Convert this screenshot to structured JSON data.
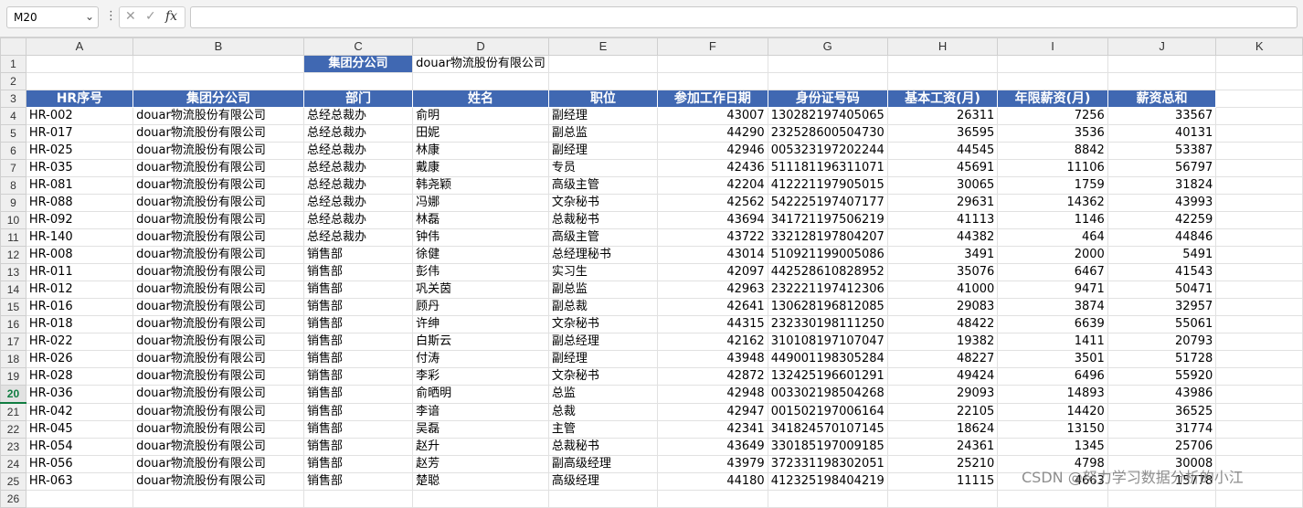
{
  "name_box": {
    "value": "M20"
  },
  "formula_bar": {
    "cancel": "✕",
    "confirm": "✓",
    "fx": "fx",
    "content": ""
  },
  "columns": [
    "A",
    "B",
    "C",
    "D",
    "E",
    "F",
    "G",
    "H",
    "I",
    "J",
    "K"
  ],
  "row1": {
    "label": "集团分公司",
    "value": "douar物流股份有限公司"
  },
  "headers": [
    "HR序号",
    "集团分公司",
    "部门",
    "姓名",
    "职位",
    "参加工作日期",
    "身份证号码",
    "基本工资(月)",
    "年限薪资(月)",
    "薪资总和"
  ],
  "rows": [
    [
      "HR-002",
      "douar物流股份有限公司",
      "总经总裁办",
      "俞明",
      "副经理",
      "43007",
      "130282197405065",
      "26311",
      "7256",
      "33567"
    ],
    [
      "HR-017",
      "douar物流股份有限公司",
      "总经总裁办",
      "田妮",
      "副总监",
      "44290",
      "232528600504730",
      "36595",
      "3536",
      "40131"
    ],
    [
      "HR-025",
      "douar物流股份有限公司",
      "总经总裁办",
      "林康",
      "副经理",
      "42946",
      "005323197202244",
      "44545",
      "8842",
      "53387"
    ],
    [
      "HR-035",
      "douar物流股份有限公司",
      "总经总裁办",
      "戴康",
      "专员",
      "42436",
      "511181196311071",
      "45691",
      "11106",
      "56797"
    ],
    [
      "HR-081",
      "douar物流股份有限公司",
      "总经总裁办",
      "韩尧颖",
      "高级主管",
      "42204",
      "412221197905015",
      "30065",
      "1759",
      "31824"
    ],
    [
      "HR-088",
      "douar物流股份有限公司",
      "总经总裁办",
      "冯娜",
      "文杂秘书",
      "42562",
      "542225197407177",
      "29631",
      "14362",
      "43993"
    ],
    [
      "HR-092",
      "douar物流股份有限公司",
      "总经总裁办",
      "林磊",
      "总裁秘书",
      "43694",
      "341721197506219",
      "41113",
      "1146",
      "42259"
    ],
    [
      "HR-140",
      "douar物流股份有限公司",
      "总经总裁办",
      "钟伟",
      "高级主管",
      "43722",
      "332128197804207",
      "44382",
      "464",
      "44846"
    ],
    [
      "HR-008",
      "douar物流股份有限公司",
      "销售部",
      "徐健",
      "总经理秘书",
      "43014",
      "510921199005086",
      "3491",
      "2000",
      "5491"
    ],
    [
      "HR-011",
      "douar物流股份有限公司",
      "销售部",
      "彭伟",
      "实习生",
      "42097",
      "442528610828952",
      "35076",
      "6467",
      "41543"
    ],
    [
      "HR-012",
      "douar物流股份有限公司",
      "销售部",
      "巩关茵",
      "副总监",
      "42963",
      "232221197412306",
      "41000",
      "9471",
      "50471"
    ],
    [
      "HR-016",
      "douar物流股份有限公司",
      "销售部",
      "顾丹",
      "副总裁",
      "42641",
      "130628196812085",
      "29083",
      "3874",
      "32957"
    ],
    [
      "HR-018",
      "douar物流股份有限公司",
      "销售部",
      "许绅",
      "文杂秘书",
      "44315",
      "232330198111250",
      "48422",
      "6639",
      "55061"
    ],
    [
      "HR-022",
      "douar物流股份有限公司",
      "销售部",
      "白斯云",
      "副总经理",
      "42162",
      "310108197107047",
      "19382",
      "1411",
      "20793"
    ],
    [
      "HR-026",
      "douar物流股份有限公司",
      "销售部",
      "付涛",
      "副经理",
      "43948",
      "449001198305284",
      "48227",
      "3501",
      "51728"
    ],
    [
      "HR-028",
      "douar物流股份有限公司",
      "销售部",
      "李彩",
      "文杂秘书",
      "42872",
      "132425196601291",
      "49424",
      "6496",
      "55920"
    ],
    [
      "HR-036",
      "douar物流股份有限公司",
      "销售部",
      "俞晒明",
      "总监",
      "42948",
      "003302198504268",
      "29093",
      "14893",
      "43986"
    ],
    [
      "HR-042",
      "douar物流股份有限公司",
      "销售部",
      "李谙",
      "总裁",
      "42947",
      "001502197006164",
      "22105",
      "14420",
      "36525"
    ],
    [
      "HR-045",
      "douar物流股份有限公司",
      "销售部",
      "吴磊",
      "主管",
      "42341",
      "341824570107145",
      "18624",
      "13150",
      "31774"
    ],
    [
      "HR-054",
      "douar物流股份有限公司",
      "销售部",
      "赵升",
      "总裁秘书",
      "43649",
      "330185197009185",
      "24361",
      "1345",
      "25706"
    ],
    [
      "HR-056",
      "douar物流股份有限公司",
      "销售部",
      "赵芳",
      "副高级经理",
      "43979",
      "372331198302051",
      "25210",
      "4798",
      "30008"
    ],
    [
      "HR-063",
      "douar物流股份有限公司",
      "销售部",
      "楚聪",
      "高级经理",
      "44180",
      "412325198404219",
      "11115",
      "4663",
      "15778"
    ]
  ],
  "partial_row": {
    "number": "26"
  },
  "selected_row": "20",
  "watermark": "CSDN @努力学习数据分析的小江",
  "colors": {
    "header_fill": "#4068b2",
    "header_text": "#ffffff",
    "selection": "#107c41"
  }
}
